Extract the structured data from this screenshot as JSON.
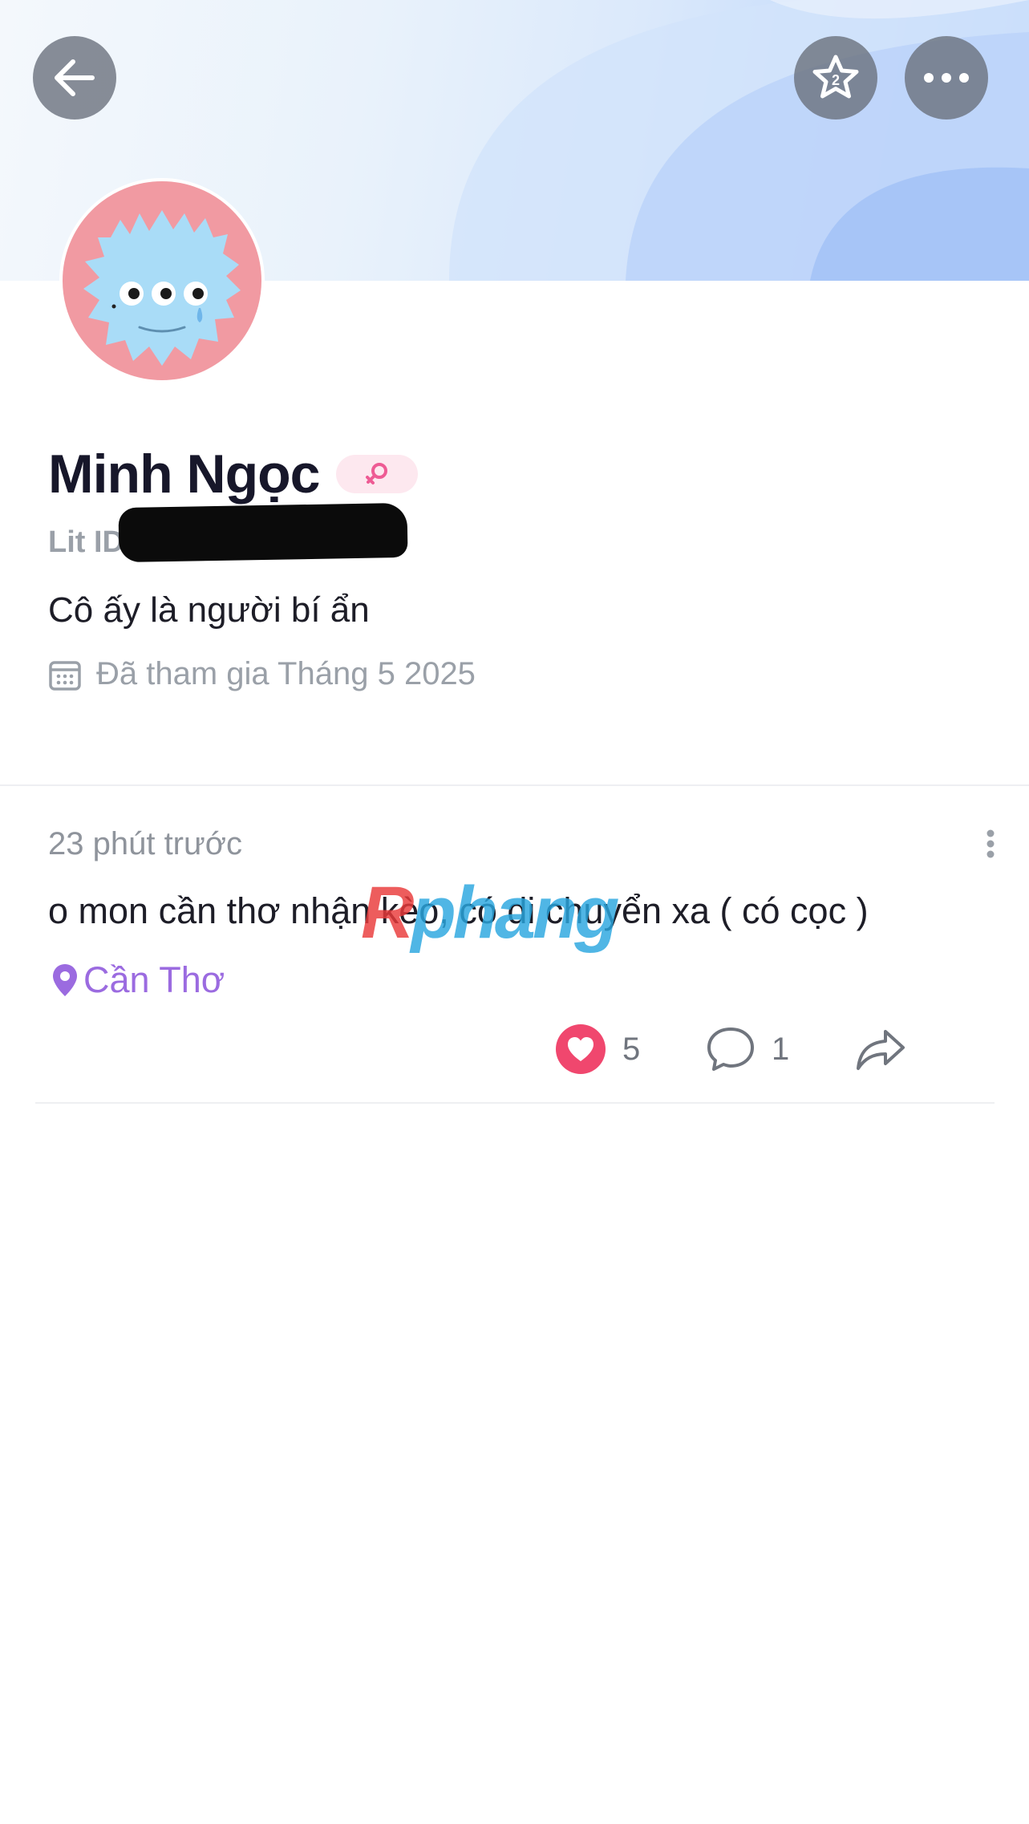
{
  "header": {
    "back_icon": "arrow-left-icon",
    "favorite_icon": "star-badge-icon",
    "more_icon": "ellipsis-horizontal-icon"
  },
  "profile": {
    "name": "Minh Ngọc",
    "gender_icon": "female-symbol-icon",
    "lit_id_label": "Lit ID",
    "bio": "Cô ấy là người bí ẩn",
    "joined_text": "Đã tham gia Tháng 5 2025"
  },
  "post": {
    "time": "23 phút trước",
    "content": "o mon cần thơ nhận kèo, có di chuyển xa ( có cọc )",
    "location": "Cần Thơ",
    "likes": "5",
    "comments": "1"
  },
  "watermark": {
    "part1": "R",
    "part2": "phang"
  },
  "colors": {
    "accent_purple": "#9b6be0",
    "like_pink": "#f0476e",
    "avatar_bg": "#f19aa2",
    "avatar_monster": "#a9dcf7"
  }
}
